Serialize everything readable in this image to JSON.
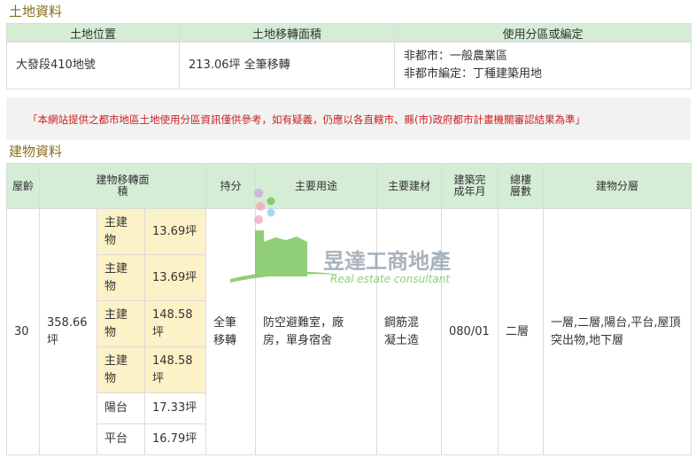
{
  "land_section": {
    "title": "土地資料",
    "headers": [
      "土地位置",
      "土地移轉面積",
      "使用分區或編定"
    ],
    "row": {
      "location": "大發段410地號",
      "area": "213.06坪 全筆移轉",
      "zoning_line1": "非都市：一般農業區",
      "zoning_line2": "非都市編定：丁種建築用地"
    }
  },
  "notice": "「本網站提供之都市地區土地使用分區資訊僅供參考，如有疑義，仍應以各直轄市、縣(市)政府都市計畫機關審認結果為準」",
  "building_section": {
    "title": "建物資料",
    "headers": {
      "age": "屋齡",
      "transfer_area": "建物移轉面積",
      "share": "持分",
      "main_use": "主要用途",
      "main_material": "主要建材",
      "completion": "建築完成年月",
      "total_floors": "總樓層數",
      "floors": "建物分層"
    },
    "row": {
      "age": "30",
      "total_area": "358.66坪",
      "share": "全筆移轉",
      "main_use": "防空避難室，廠房，單身宿舍",
      "main_material": "鋼筋混凝土造",
      "completion": "080/01",
      "total_floors": "二層",
      "floors": "一層,二層,陽台,平台,屋頂突出物,地下層"
    },
    "area_items": [
      {
        "label": "主建物",
        "value": "13.69坪",
        "main": true
      },
      {
        "label": "主建物",
        "value": "13.69坪",
        "main": true
      },
      {
        "label": "主建物",
        "value": "148.58坪",
        "main": true
      },
      {
        "label": "主建物",
        "value": "148.58坪",
        "main": true
      },
      {
        "label": "陽台",
        "value": "17.33坪",
        "main": false
      },
      {
        "label": "平台",
        "value": "16.79坪",
        "main": false
      }
    ]
  },
  "watermark": {
    "name": "昱達工商地產",
    "sub": "Real estate consultant",
    "colors": {
      "green": "#6cc04a",
      "pink": "#f3a3b8",
      "blue": "#8fc9ef",
      "purple": "#c9a6e0",
      "text": "#8c9aa7"
    }
  }
}
